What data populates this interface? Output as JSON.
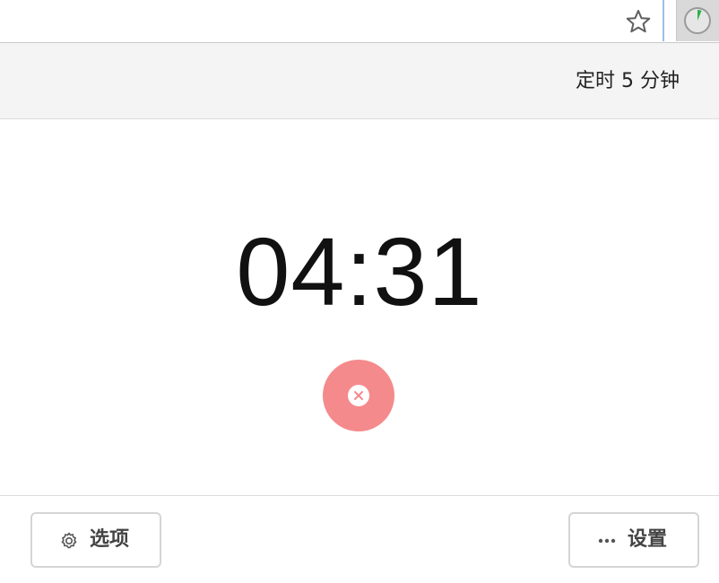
{
  "browser": {
    "bookmark_icon": "star-outline-icon",
    "extension_icon": "timer-clock-icon",
    "extension_accent": "#2bb24c"
  },
  "popup": {
    "header_title": "定时 5 分钟",
    "time_remaining": "04:31",
    "cancel_button": {
      "icon": "close-icon",
      "color": "#f48a8c"
    },
    "footer": {
      "options_label": "选项",
      "options_icon": "gear-icon",
      "settings_label": "设置",
      "settings_icon": "more-dots-icon"
    }
  }
}
